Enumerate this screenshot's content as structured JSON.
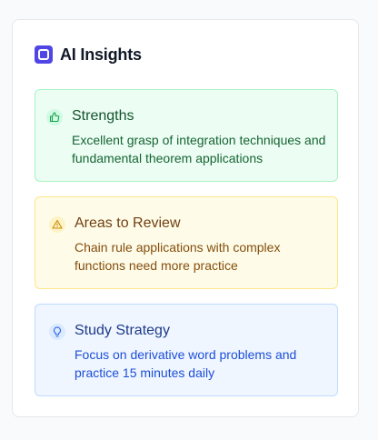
{
  "panel": {
    "title": "AI Insights",
    "icon": "ai-chip-icon"
  },
  "cards": [
    {
      "type": "strengths",
      "icon": "thumbs-up-icon",
      "title": "Strengths",
      "text": "Excellent grasp of integration techniques and fundamental theorem applications",
      "accent": "#16a34a"
    },
    {
      "type": "review",
      "icon": "warning-triangle-icon",
      "title": "Areas to Review",
      "text": "Chain rule applications with complex functions need more practice",
      "accent": "#ca8a04"
    },
    {
      "type": "strategy",
      "icon": "lightbulb-icon",
      "title": "Study Strategy",
      "text": "Focus on derivative word problems and practice 15 minutes daily",
      "accent": "#2563eb"
    }
  ]
}
